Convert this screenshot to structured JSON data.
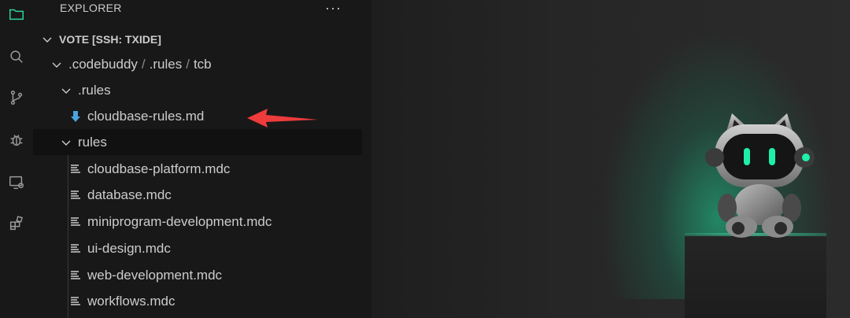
{
  "sidebar": {
    "title": "EXPLORER",
    "more_label": "···",
    "root": "VOTE [SSH: TXIDE]",
    "path_parts": [
      ".codebuddy",
      "/",
      ".rules",
      "/",
      "tcb"
    ],
    "folders": {
      "dot_rules": ".rules",
      "rules": "rules"
    },
    "files": [
      {
        "name": "cloudbase-rules.md",
        "icon": "download-arrow-icon"
      },
      {
        "name": "cloudbase-platform.mdc",
        "icon": "lines-icon"
      },
      {
        "name": "database.mdc",
        "icon": "lines-icon"
      },
      {
        "name": "miniprogram-development.mdc",
        "icon": "lines-icon"
      },
      {
        "name": "ui-design.mdc",
        "icon": "lines-icon"
      },
      {
        "name": "web-development.mdc",
        "icon": "lines-icon"
      },
      {
        "name": "workflows.mdc",
        "icon": "lines-icon"
      }
    ]
  },
  "activity_icons": [
    "files-icon",
    "search-icon",
    "source-control-icon",
    "debug-icon",
    "remote-explorer-icon",
    "extensions-icon"
  ],
  "colors": {
    "accent_green": "#1ed696",
    "annotation_red": "#ee3b3b",
    "file_md_icon": "#4aa3df"
  }
}
